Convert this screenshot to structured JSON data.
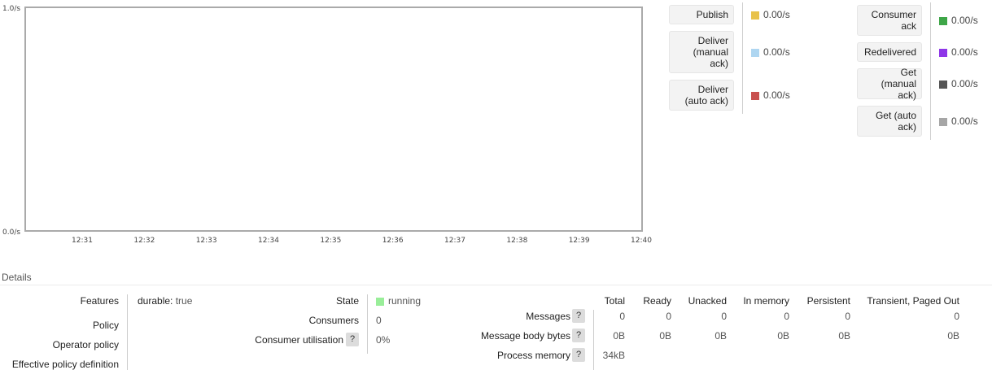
{
  "chart_data": {
    "type": "line",
    "x": [
      "12:31",
      "12:32",
      "12:33",
      "12:34",
      "12:35",
      "12:36",
      "12:37",
      "12:38",
      "12:39",
      "12:40"
    ],
    "ylim": [
      0,
      1.0
    ],
    "y_tick_labels": [
      "1.0/s",
      "0.0/s"
    ],
    "series": [
      {
        "name": "Publish",
        "values": []
      },
      {
        "name": "Deliver (manual ack)",
        "values": []
      },
      {
        "name": "Deliver (auto ack)",
        "values": []
      },
      {
        "name": "Consumer ack",
        "values": []
      },
      {
        "name": "Redelivered",
        "values": []
      },
      {
        "name": "Get (manual ack)",
        "values": []
      },
      {
        "name": "Get (auto ack)",
        "values": []
      }
    ],
    "grid": false
  },
  "legend": {
    "left": [
      {
        "label": "Publish",
        "color": "#e8c24a",
        "value": "0.00/s"
      },
      {
        "label": "Deliver (manual ack)",
        "color": "#aed6f1",
        "value": "0.00/s"
      },
      {
        "label": "Deliver (auto ack)",
        "color": "#c9514f",
        "value": "0.00/s"
      }
    ],
    "right": [
      {
        "label": "Consumer ack",
        "color": "#3ea648",
        "value": "0.00/s"
      },
      {
        "label": "Redelivered",
        "color": "#8e36e8",
        "value": "0.00/s"
      },
      {
        "label": "Get (manual ack)",
        "color": "#555555",
        "value": "0.00/s"
      },
      {
        "label": "Get (auto ack)",
        "color": "#a6a6a6",
        "value": "0.00/s"
      }
    ]
  },
  "details": {
    "title": "Details",
    "features_label": "Features",
    "features_key": "durable:",
    "features_value": "true",
    "policy_label": "Policy",
    "operator_policy_label": "Operator policy",
    "effective_policy_label": "Effective policy definition",
    "state_label": "State",
    "state_value": "running",
    "state_color": "#99ee99",
    "consumers_label": "Consumers",
    "consumers_value": "0",
    "utilisation_label": "Consumer utilisation",
    "utilisation_value": "0%",
    "help_glyph": "?",
    "table": {
      "headers": [
        "Total",
        "Ready",
        "Unacked",
        "In memory",
        "Persistent",
        "Transient, Paged Out"
      ],
      "rows": [
        {
          "label": "Messages",
          "cells": [
            "0",
            "0",
            "0",
            "0",
            "0",
            "0"
          ]
        },
        {
          "label": "Message body bytes",
          "cells": [
            "0B",
            "0B",
            "0B",
            "0B",
            "0B",
            "0B"
          ]
        },
        {
          "label": "Process memory",
          "cells": [
            "34kB",
            "",
            "",
            "",
            "",
            ""
          ]
        }
      ]
    }
  }
}
